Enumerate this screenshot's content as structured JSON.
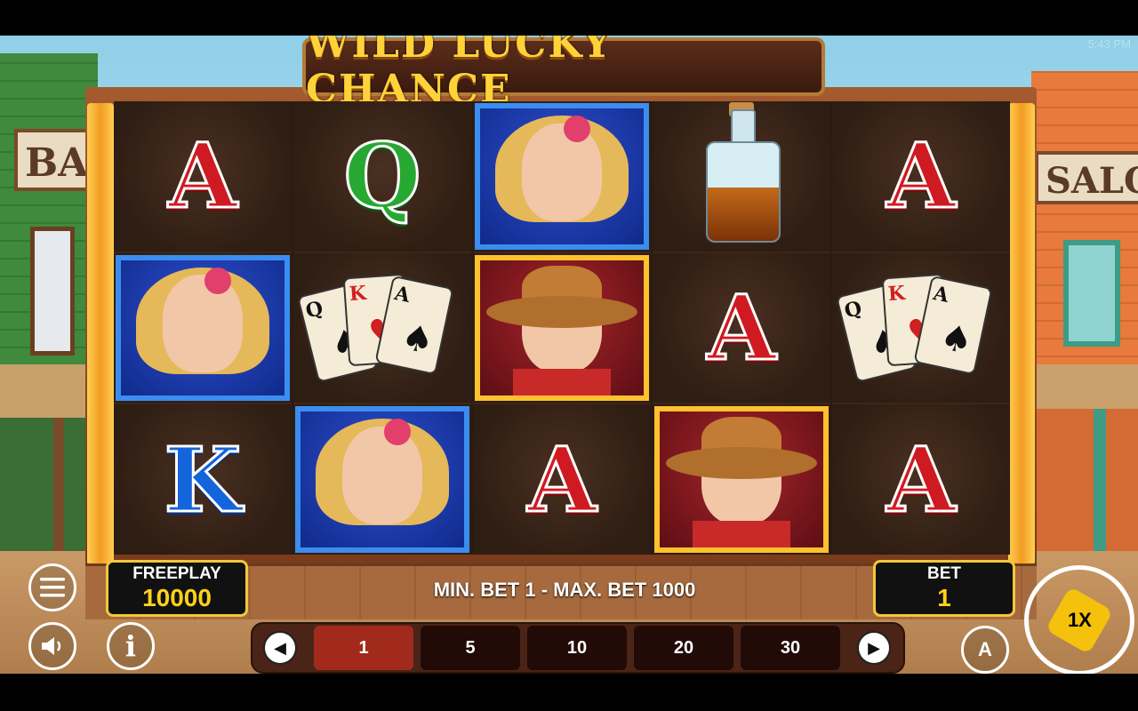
{
  "status_bar": {
    "time": "5:43 PM"
  },
  "background": {
    "left_sign": "BA",
    "right_sign": "SALO"
  },
  "game": {
    "title": "WILD LUCKY CHANCE"
  },
  "reels": [
    [
      "A",
      "lady",
      "K"
    ],
    [
      "Q",
      "cards",
      "lady"
    ],
    [
      "lady",
      "cowboy",
      "A"
    ],
    [
      "bottle",
      "A",
      "cowboy"
    ],
    [
      "A",
      "cards",
      "A"
    ]
  ],
  "symbol_styles": {
    "A": {
      "kind": "letter",
      "color": "red"
    },
    "K": {
      "kind": "letter",
      "color": "blue"
    },
    "Q": {
      "kind": "letter",
      "color": "green"
    }
  },
  "cards_labels": {
    "q": "Q",
    "k": "K",
    "a": "A",
    "pip_q": "♠",
    "pip_k": "♥",
    "pip_a": "♠"
  },
  "freeplay": {
    "label": "FREEPLAY",
    "value": "10000"
  },
  "bet": {
    "label": "BET",
    "value": "1"
  },
  "bet_limits": "MIN. BET 1 - MAX. BET 1000",
  "bet_options": [
    "1",
    "5",
    "10",
    "20",
    "30"
  ],
  "selected_bet_index": 0,
  "controls": {
    "menu_icon": "hamburger-icon",
    "sound_icon": "speaker-icon",
    "info_icon": "info-icon",
    "autoplay_icon": "autoplay-icon",
    "autoplay_label": "A",
    "info_label": "i",
    "spin_logo": "1X",
    "prev_arrow": "◀",
    "next_arrow": "▶"
  },
  "colors": {
    "panel_border": "#f0c83b",
    "value_yellow": "#ffd11a",
    "selected_bet": "#a12a1c"
  }
}
